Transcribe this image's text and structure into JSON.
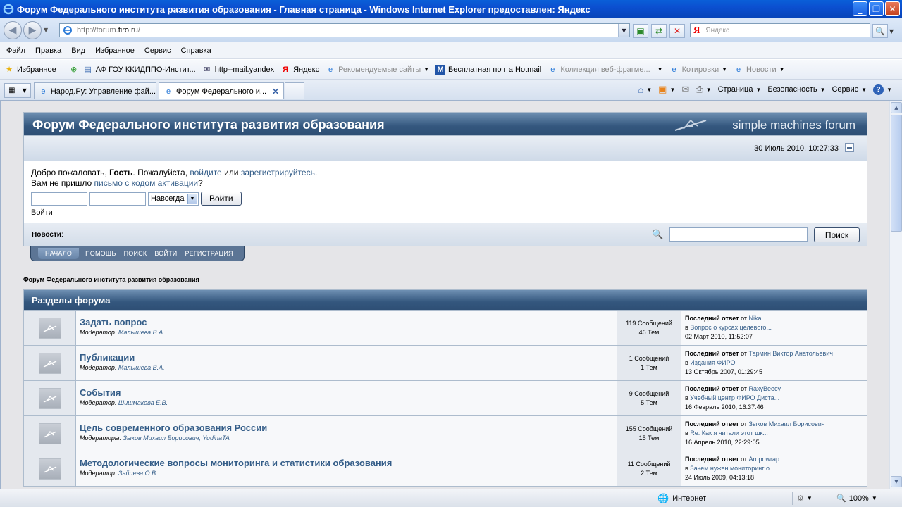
{
  "window": {
    "title": "Форум Федерального института развития образования - Главная страница - Windows Internet Explorer предоставлен: Яндекс"
  },
  "address": {
    "url_prefix": "http://forum.",
    "url_domain": "firo.ru",
    "url_suffix": "/",
    "search_placeholder": "Яндекс"
  },
  "menu": [
    "Файл",
    "Правка",
    "Вид",
    "Избранное",
    "Сервис",
    "Справка"
  ],
  "favorites": {
    "label": "Избранное",
    "items": [
      {
        "label": "АФ ГОУ ККИДППО-Инстит..."
      },
      {
        "label": "http--mail.yandex"
      },
      {
        "label": "Яндекс"
      },
      {
        "label": "Рекомендуемые сайты"
      },
      {
        "label": "Бесплатная почта Hotmail"
      },
      {
        "label": "Коллекция веб-фрагме..."
      },
      {
        "label": "Котировки"
      },
      {
        "label": "Новости"
      }
    ]
  },
  "tabs": [
    {
      "label": "Народ.Ру: Управление фай..."
    },
    {
      "label": "Форум Федерального и..."
    }
  ],
  "commands": {
    "page": "Страница",
    "safety": "Безопасность",
    "tools": "Сервис"
  },
  "forum": {
    "title": "Форум Федерального института развития образования",
    "smf": "simple machines forum",
    "datetime": "30 Июль 2010, 10:27:33",
    "welcome_pre": "Добро пожаловать, ",
    "guest": "Гость",
    "welcome_mid": ". Пожалуйста, ",
    "login_link": "войдите",
    "or": " или ",
    "register_link": "зарегистрируйтесь",
    "dot": ".",
    "no_email_pre": "Вам не пришло ",
    "activation_link": "письмо с кодом активации",
    "qmark": "?",
    "duration": "Навсегда",
    "login_button": "Войти",
    "login_label": "Войти",
    "news_label": "Новости",
    "news_colon": ":",
    "search_button": "Поиск",
    "navtabs": [
      "НАЧАЛО",
      "ПОМОЩЬ",
      "ПОИСК",
      "ВОЙТИ",
      "РЕГИСТРАЦИЯ"
    ],
    "linktree": "Форум Федерального института развития образования",
    "category": "Разделы форума",
    "last_post_label": "Последний ответ",
    "from": " от ",
    "in": "в ",
    "boards": [
      {
        "name": "Задать вопрос",
        "mod_label": "Модератор:",
        "mods": "Малышева В.А.",
        "posts": "119 Сообщений",
        "topics": "46 Тем",
        "last_by": "Nika",
        "last_in": "Вопрос о курсах целевого...",
        "last_date": "02 Март 2010, 11:52:07"
      },
      {
        "name": "Публикации",
        "mod_label": "Модератор:",
        "mods": "Малышева В.А.",
        "posts": "1 Сообщений",
        "topics": "1 Тем",
        "last_by": "Тармин Виктор Анатольевич",
        "last_in": "Издания ФИРО",
        "last_date": "13 Октябрь 2007, 01:29:45"
      },
      {
        "name": "События",
        "mod_label": "Модератор:",
        "mods": "Шишмакова Е.В.",
        "posts": "9 Сообщений",
        "topics": "5 Тем",
        "last_by": "RaxyBeecy",
        "last_in": "Учебный центр ФИРО Диста...",
        "last_date": "16 Февраль 2010, 16:37:46"
      },
      {
        "name": "Цель современного образования России",
        "mod_label": "Модераторы:",
        "mods": "Зыков Михаил Борисович, YudinaTA",
        "posts": "155 Сообщений",
        "topics": "15 Тем",
        "last_by": "Зыков Михаил Борисович",
        "last_in": "Re: Как я читали этот шк...",
        "last_date": "16 Апрель 2010, 22:29:05"
      },
      {
        "name": "Методологические вопросы мониторинга и статистики образования",
        "mod_label": "Модератор:",
        "mods": "Зайцева О.В.",
        "posts": "11 Сообщений",
        "topics": "2 Тем",
        "last_by": "Aropowrap",
        "last_in": "Зачем нужен мониторинг о...",
        "last_date": "24 Июль 2009, 04:13:18"
      }
    ]
  },
  "status": {
    "zone": "Интернет",
    "zoom": "100%"
  }
}
